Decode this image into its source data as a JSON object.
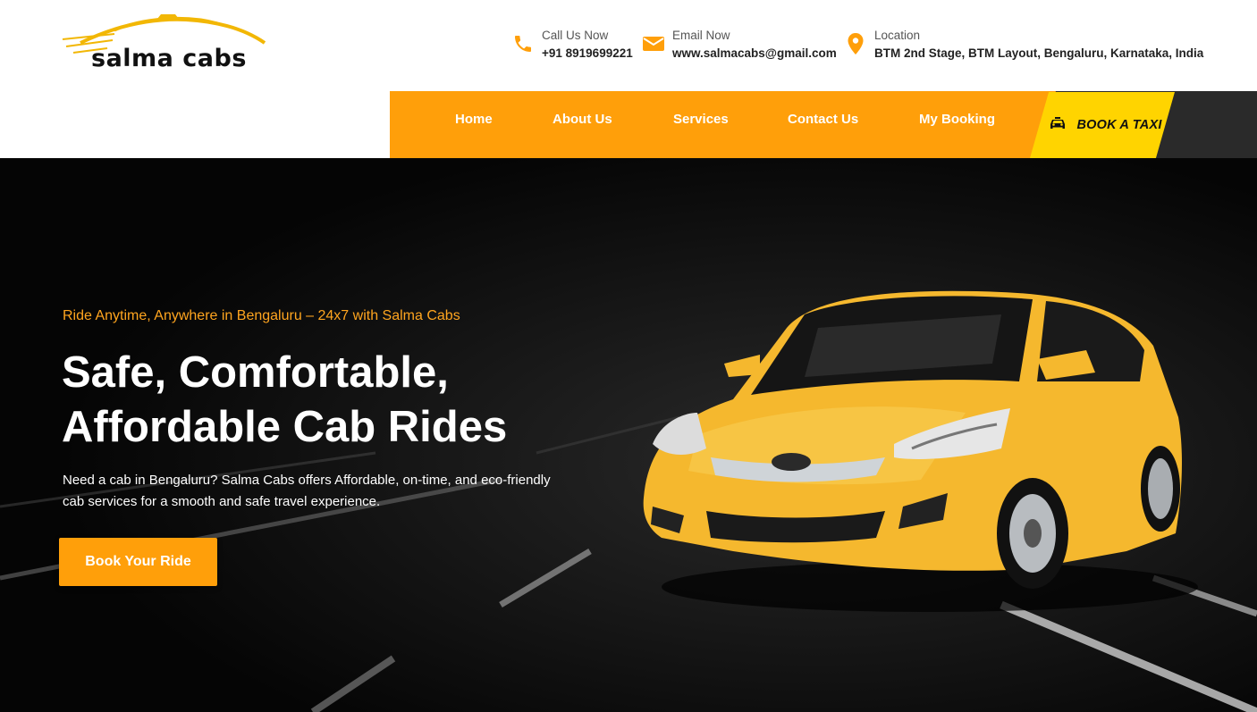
{
  "brand": {
    "name": "salma cabs"
  },
  "header": {
    "call": {
      "label": "Call Us Now",
      "value": "+91 8919699221"
    },
    "email": {
      "label": "Email Now",
      "value": "www.salmacabs@gmail.com"
    },
    "location": {
      "label": "Location",
      "value": "BTM 2nd Stage, BTM Layout, Bengaluru, Karnataka, India"
    }
  },
  "nav": {
    "items": [
      "Home",
      "About Us",
      "Services",
      "Contact Us",
      "My Booking"
    ],
    "book_taxi": "BOOK A TAXI"
  },
  "hero": {
    "tagline": "Ride Anytime, Anywhere in Bengaluru – 24x7 with Salma Cabs",
    "headline_line1": "Safe, Comfortable,",
    "headline_line2": "Affordable Cab Rides",
    "description": "Need a cab in Bengaluru? Salma Cabs offers Affordable, on-time, and eco-friendly cab services for a smooth and safe travel experience.",
    "cta": "Book Your Ride"
  },
  "colors": {
    "accent": "#ff9f0a",
    "taxi_yellow": "#ffd400",
    "dark": "#050505"
  },
  "icons": {
    "call": "phone-icon",
    "email": "envelope-icon",
    "location": "map-pin-icon",
    "taxi": "taxi-icon"
  }
}
